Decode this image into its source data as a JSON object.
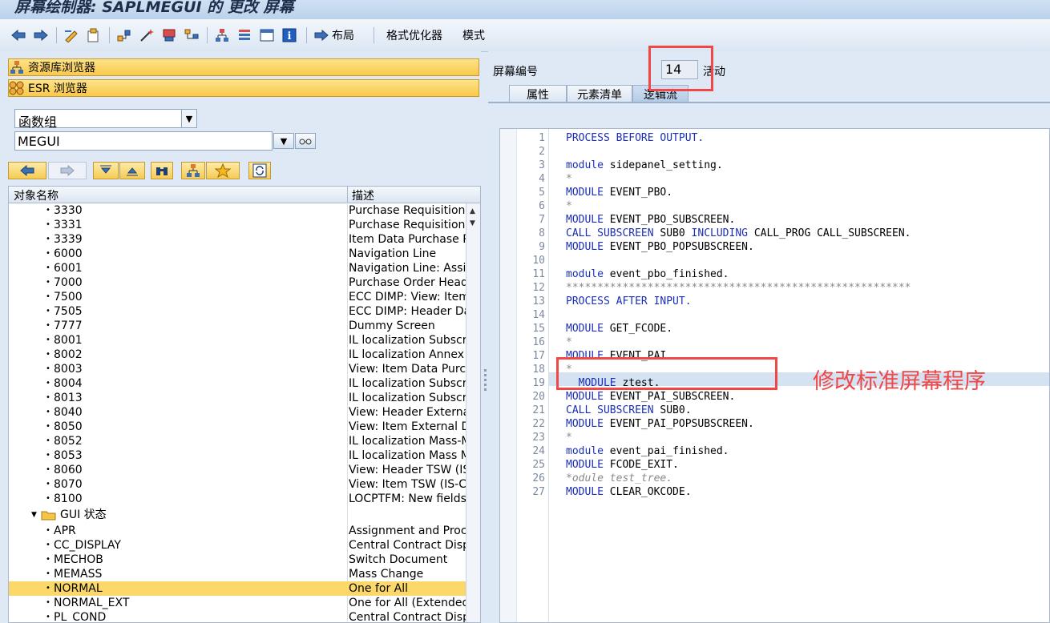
{
  "title": "屏幕绘制器: SAPLMEGUI 的 更改 屏幕",
  "toolbar": {
    "layout_label": "布局",
    "format_label": "格式优化器",
    "mode_label": "模式"
  },
  "left": {
    "repo_browser": "资源库浏览器",
    "esr_browser": "ESR 浏览器",
    "object_type": "函数组",
    "object_name": "MEGUI",
    "columns": {
      "name": "对象名称",
      "desc": "描述"
    },
    "screens": [
      {
        "name": "3330",
        "desc": "Purchase Requisition: E"
      },
      {
        "name": "3331",
        "desc": "Purchase Requisition It"
      },
      {
        "name": "3339",
        "desc": "Item Data Purchase R"
      },
      {
        "name": "6000",
        "desc": "Navigation Line"
      },
      {
        "name": "6001",
        "desc": "Navigation Line: Assigr"
      },
      {
        "name": "7000",
        "desc": "Purchase Order Heade"
      },
      {
        "name": "7500",
        "desc": "ECC DIMP: View: Item"
      },
      {
        "name": "7505",
        "desc": "ECC DIMP: Header Da"
      },
      {
        "name": "7777",
        "desc": "Dummy Screen"
      },
      {
        "name": "8001",
        "desc": "IL localization Subscre"
      },
      {
        "name": "8002",
        "desc": "IL localization Annex d"
      },
      {
        "name": "8003",
        "desc": "View: Item Data Purch"
      },
      {
        "name": "8004",
        "desc": "IL localization Subscre"
      },
      {
        "name": "8013",
        "desc": "IL localization Subscre"
      },
      {
        "name": "8040",
        "desc": "View: Header External"
      },
      {
        "name": "8050",
        "desc": "View: Item External D"
      },
      {
        "name": "8052",
        "desc": "IL localization Mass-Ma"
      },
      {
        "name": "8053",
        "desc": "IL localization Mass Ma"
      },
      {
        "name": "8060",
        "desc": "View: Header TSW (IS"
      },
      {
        "name": "8070",
        "desc": "View: Item TSW (IS-C"
      },
      {
        "name": "8100",
        "desc": "LOCPTFM: New fields"
      }
    ],
    "gui_folder": "GUI 状态",
    "gui_status": [
      {
        "name": "APR",
        "desc": "Assignment and Proce"
      },
      {
        "name": "CC_DISPLAY",
        "desc": "Central Contract Displa"
      },
      {
        "name": "MECHOB",
        "desc": "Switch Document"
      },
      {
        "name": "MEMASS",
        "desc": "Mass Change"
      },
      {
        "name": "NORMAL",
        "desc": "One for All"
      },
      {
        "name": "NORMAL_EXT",
        "desc": "One for All (Extended"
      },
      {
        "name": "PL_COND",
        "desc": "Central Contract Displa"
      }
    ],
    "selected_index": 4
  },
  "right": {
    "screen_label": "屏幕编号",
    "screen_number": "14",
    "status": "活动",
    "tabs": [
      "属性",
      "元素清单",
      "逻辑流"
    ],
    "active_tab": 2,
    "code": [
      [
        [
          "kw",
          "PROCESS BEFORE OUTPUT."
        ]
      ],
      [],
      [
        [
          "kw",
          "module"
        ],
        [
          "t",
          " sidepanel_setting."
        ]
      ],
      [
        [
          "cmt",
          "*"
        ]
      ],
      [
        [
          "kw",
          "MODULE"
        ],
        [
          "t",
          " EVENT_PBO."
        ]
      ],
      [
        [
          "cmt",
          "*"
        ]
      ],
      [
        [
          "kw",
          "MODULE"
        ],
        [
          "t",
          " EVENT_PBO_SUBSCREEN."
        ]
      ],
      [
        [
          "kw",
          "CALL SUBSCREEN"
        ],
        [
          "t",
          " SUB0 "
        ],
        [
          "kw",
          "INCLUDING"
        ],
        [
          "t",
          " CALL_PROG CALL_SUBSCREEN."
        ]
      ],
      [
        [
          "kw",
          "MODULE"
        ],
        [
          "t",
          " EVENT_PBO_POPSUBSCREEN."
        ]
      ],
      [],
      [
        [
          "kw",
          "module"
        ],
        [
          "t",
          " event_pbo_finished."
        ]
      ],
      [
        [
          "cmt",
          "*******************************************************"
        ]
      ],
      [
        [
          "kw",
          "PROCESS AFTER INPUT."
        ]
      ],
      [],
      [
        [
          "kw",
          "MODULE"
        ],
        [
          "t",
          " GET_FCODE."
        ]
      ],
      [
        [
          "cmt",
          "*"
        ]
      ],
      [
        [
          "kw",
          "MODULE"
        ],
        [
          "t",
          " EVENT_PAI."
        ]
      ],
      [
        [
          "cmt",
          "*"
        ]
      ],
      [
        [
          "t",
          "  "
        ],
        [
          "kw",
          "MODULE"
        ],
        [
          "t",
          " ztest."
        ]
      ],
      [
        [
          "kw",
          "MODULE"
        ],
        [
          "t",
          " EVENT_PAI_SUBSCREEN."
        ]
      ],
      [
        [
          "kw",
          "CALL SUBSCREEN"
        ],
        [
          "t",
          " SUB0."
        ]
      ],
      [
        [
          "kw",
          "MODULE"
        ],
        [
          "t",
          " EVENT_PAI_POPSUBSCREEN."
        ]
      ],
      [
        [
          "cmt",
          "*"
        ]
      ],
      [
        [
          "kw",
          "module"
        ],
        [
          "t",
          " event_pai_finished."
        ]
      ],
      [
        [
          "kw",
          "MODULE"
        ],
        [
          "t",
          " FCODE_EXIT."
        ]
      ],
      [
        [
          "cmt",
          "*odule test_tree."
        ]
      ],
      [
        [
          "kw",
          "MODULE"
        ],
        [
          "t",
          " CLEAR_OKCODE."
        ]
      ]
    ],
    "highlight_line": 19
  },
  "annotation": "修改标准屏幕程序",
  "colors": {
    "keyword": "#1a2fb5",
    "comment": "#8a8a8a",
    "annotation": "#f04747",
    "selection": "#fcd86b"
  }
}
